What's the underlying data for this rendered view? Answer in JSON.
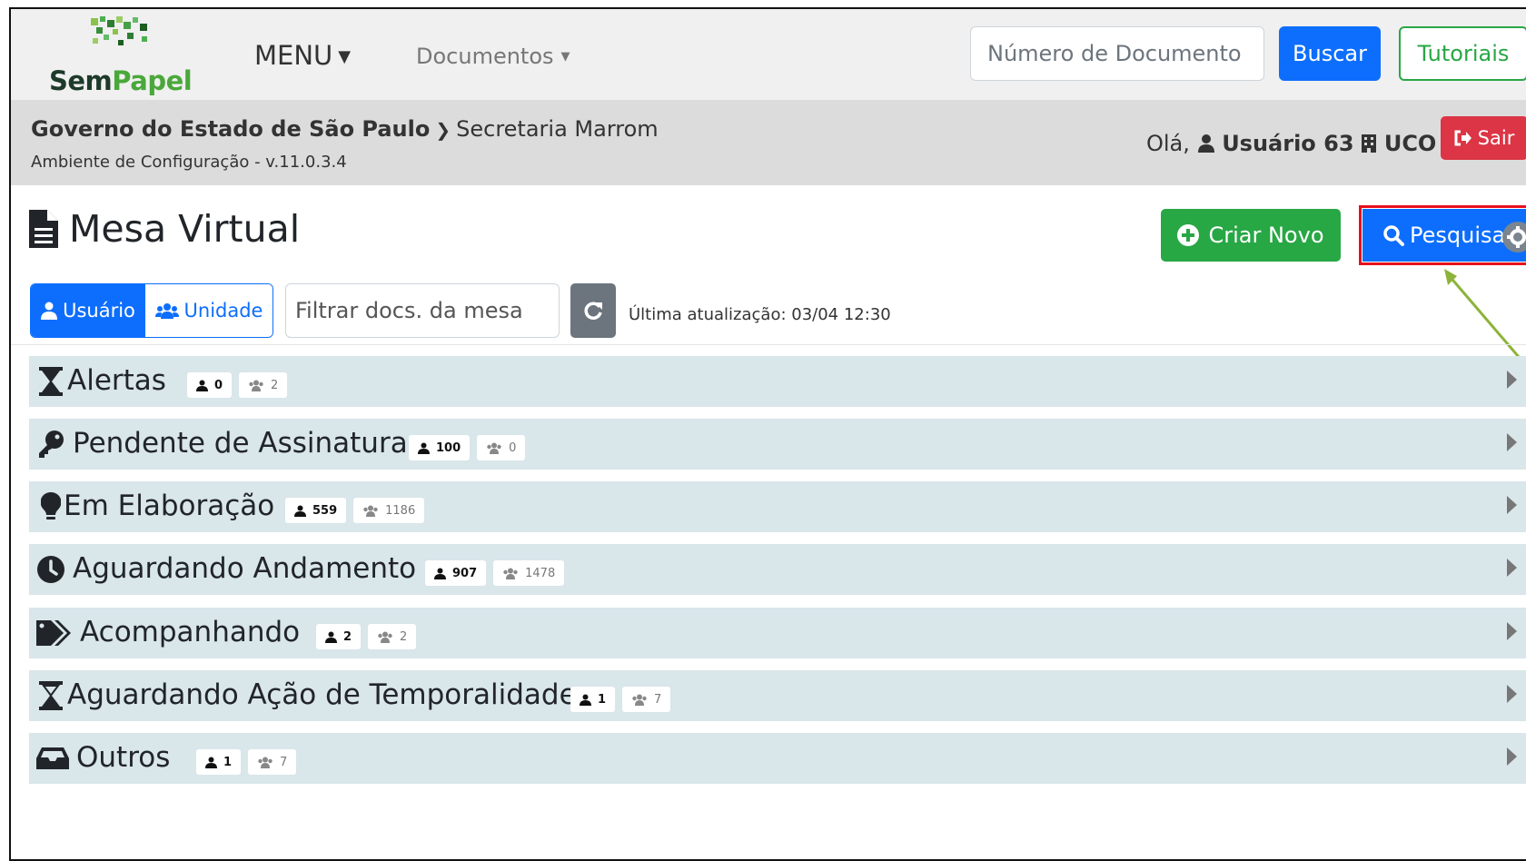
{
  "brand": {
    "logo_part1": "Sem",
    "logo_part2": "Papel"
  },
  "navbar": {
    "menu_label": "MENU",
    "documents_label": "Documentos",
    "search_placeholder": "Número de Documento",
    "search_button": "Buscar",
    "tutorials_button": "Tutoriais"
  },
  "context": {
    "breadcrumb_root": "Governo do Estado de São Paulo",
    "breadcrumb_current": "Secretaria Marrom",
    "environment": "Ambiente de Configuração - v.11.0.3.4",
    "greeting": "Olá,",
    "user_name": "Usuário 63",
    "unit_name": "UCO",
    "logout_button": "Sair"
  },
  "page": {
    "title": "Mesa Virtual",
    "create_button": "Criar Novo",
    "search_button": "Pesquisar"
  },
  "filters": {
    "scope_user": "Usuário",
    "scope_unit": "Unidade",
    "filter_placeholder": "Filtrar docs. da mesa",
    "last_update": "Última atualização: 03/04 12:30"
  },
  "sections": [
    {
      "title": "Alertas",
      "icon": "hourglass-icon",
      "user_count": "0",
      "unit_count": "2"
    },
    {
      "title": "Pendente de Assinatura",
      "icon": "key-icon",
      "user_count": "100",
      "unit_count": "0"
    },
    {
      "title": "Em Elaboração",
      "icon": "lightbulb-icon",
      "user_count": "559",
      "unit_count": "1186"
    },
    {
      "title": "Aguardando Andamento",
      "icon": "clock-icon",
      "user_count": "907",
      "unit_count": "1478"
    },
    {
      "title": "Acompanhando",
      "icon": "tags-icon",
      "user_count": "2",
      "unit_count": "2"
    },
    {
      "title": "Aguardando Ação de Temporalidade",
      "icon": "hourglass-icon",
      "user_count": "1",
      "unit_count": "7"
    },
    {
      "title": "Outros",
      "icon": "inbox-icon",
      "user_count": "1",
      "unit_count": "7"
    }
  ],
  "colors": {
    "primary": "#0d6efd",
    "success": "#28a745",
    "danger": "#dc3545",
    "section_bg": "#d9e6ea",
    "highlight": "#e8101c",
    "annotation_arrow": "#8db33a"
  }
}
